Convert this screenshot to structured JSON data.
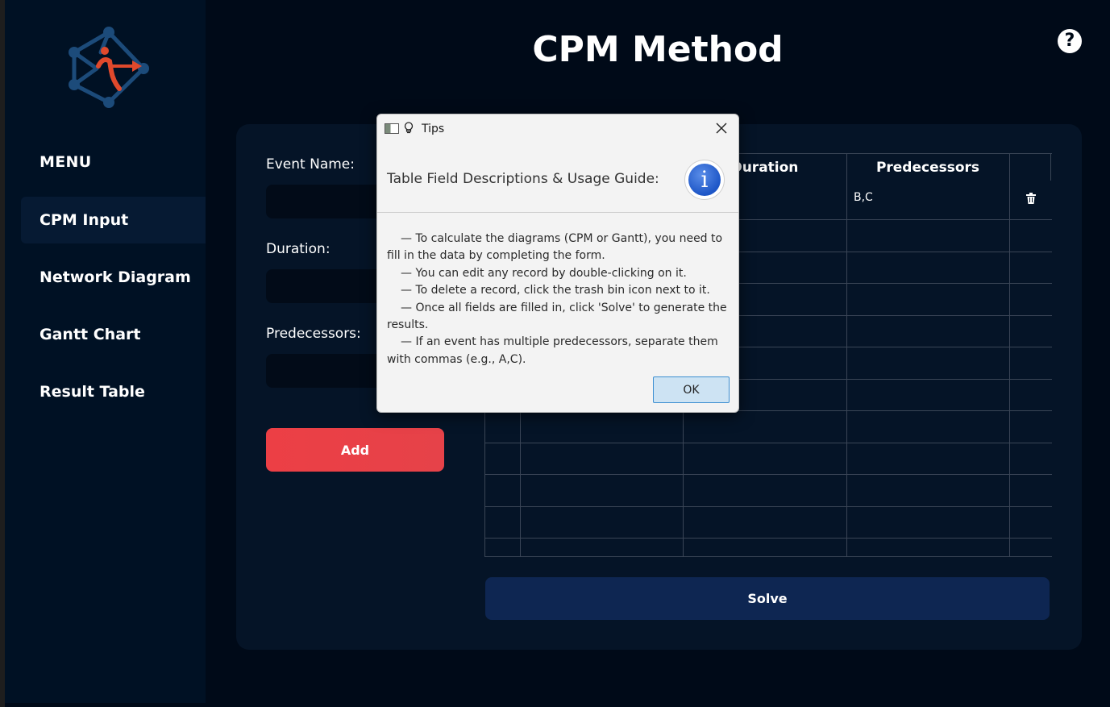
{
  "app": {
    "title": "CPM Method",
    "help_label": "?"
  },
  "sidebar": {
    "menu_title": "MENU",
    "items": [
      {
        "label": "CPM Input",
        "active": true
      },
      {
        "label": "Network Diagram",
        "active": false
      },
      {
        "label": "Gantt Chart",
        "active": false
      },
      {
        "label": "Result Table",
        "active": false
      }
    ]
  },
  "form": {
    "event_name_label": "Event Name:",
    "duration_label": "Duration:",
    "predecessors_label": "Predecessors:",
    "event_name_value": "",
    "duration_value": "",
    "predecessors_value": "",
    "add_label": "Add"
  },
  "table": {
    "headers": {
      "duration": "Duration",
      "predecessors": "Predecessors"
    },
    "rows": [
      {
        "predecessors": "B,C"
      }
    ]
  },
  "solve_label": "Solve",
  "dialog": {
    "title": "Tips",
    "header": "Table Field Descriptions & Usage Guide:",
    "info_glyph": "i",
    "lines": [
      "— To calculate the diagrams (CPM or Gantt), you need to fill in the data by completing the form.",
      "— You can edit any record by double-clicking on it.",
      "— To delete a record, click the trash bin icon next to it.",
      "— Once all fields are filled in, click 'Solve' to generate the results.",
      "— If an event has multiple predecessors, separate them with commas (e.g., A,C)."
    ],
    "ok_label": "OK"
  },
  "colors": {
    "background": "#000a18",
    "sidebar": "#001124",
    "panel": "#051427",
    "add_button": "#ec3f45",
    "solve_button": "#0e2652",
    "logo_blue": "#1c4b7a",
    "logo_red": "#e0492c"
  }
}
